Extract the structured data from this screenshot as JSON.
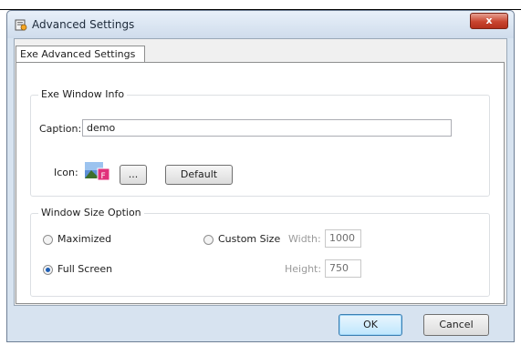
{
  "window": {
    "title": "Advanced Settings",
    "close_symbol": "x",
    "app_icon": "settings-app-icon"
  },
  "tab": {
    "label": "Exe Advanced Settings"
  },
  "exe_window_info": {
    "group_label": "Exe Window Info",
    "caption_label": "Caption:",
    "caption_value": "demo",
    "icon_label": "Icon:",
    "browse_label": "...",
    "default_label": "Default",
    "icon_preview": "image-file-icon"
  },
  "window_size_option": {
    "group_label": "Window Size Option",
    "maximized_label": "Maximized",
    "full_screen_label": "Full Screen",
    "custom_size_label": "Custom Size",
    "width_label": "Width:",
    "width_value": "1000",
    "height_label": "Height:",
    "height_value": "750",
    "selected": "Full Screen"
  },
  "footer": {
    "ok_label": "OK",
    "cancel_label": "Cancel"
  },
  "colors": {
    "accent": "#1f5fb5",
    "close": "#c9452f",
    "frame": "#d7e3f0"
  }
}
